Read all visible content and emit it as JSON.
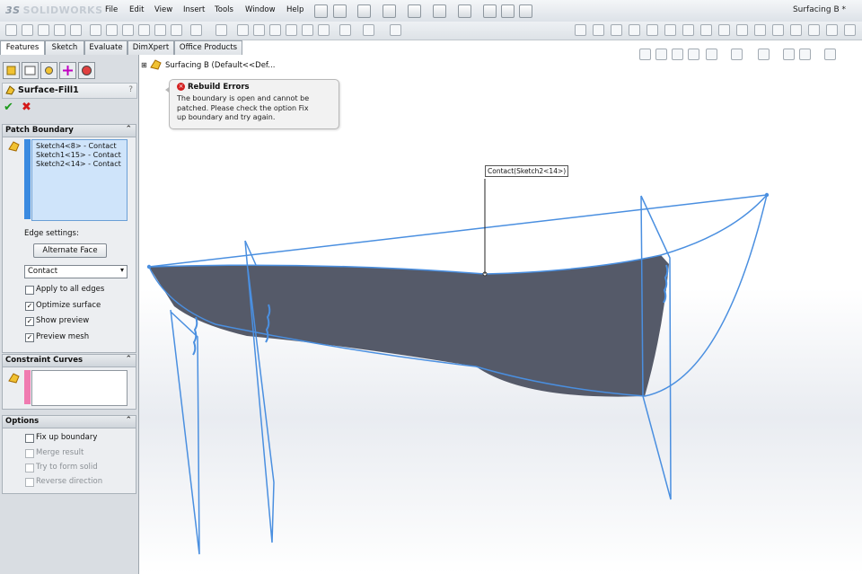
{
  "app": {
    "name": "SOLIDWORKS",
    "ds_mark": "3S",
    "document_title": "Surfacing B *"
  },
  "menu": [
    "File",
    "Edit",
    "View",
    "Insert",
    "Tools",
    "Window",
    "Help"
  ],
  "tabs": [
    "Features",
    "Sketch",
    "Evaluate",
    "DimXpert",
    "Office Products"
  ],
  "feature": {
    "title": "Surface-Fill1",
    "help": "?"
  },
  "patch_boundary": {
    "header": "Patch Boundary",
    "items": [
      "Sketch4<8> - Contact",
      "Sketch1<15> - Contact",
      "Sketch2<14> - Contact"
    ],
    "edge_settings_label": "Edge settings:",
    "alternate_face_button": "Alternate Face",
    "contact_select": "Contact",
    "checkboxes": [
      {
        "label": "Apply to all edges",
        "checked": false
      },
      {
        "label": "Optimize surface",
        "checked": true
      },
      {
        "label": "Show preview",
        "checked": true
      },
      {
        "label": "Preview mesh",
        "checked": true
      }
    ]
  },
  "constraint_curves": {
    "header": "Constraint Curves"
  },
  "options": {
    "header": "Options",
    "checkboxes": [
      {
        "label": "Fix up boundary",
        "enabled": true
      },
      {
        "label": "Merge result",
        "enabled": false
      },
      {
        "label": "Try to form solid",
        "enabled": false
      },
      {
        "label": "Reverse direction",
        "enabled": false
      }
    ]
  },
  "tree": {
    "label": "Surfacing B  (Default<<Def..."
  },
  "rebuild_error": {
    "title": "Rebuild Errors",
    "message_lines": [
      "The boundary is open and cannot be",
      "patched. Please check the option Fix",
      "up boundary and try again."
    ]
  },
  "callout": {
    "label": "Contact(Sketch2<14>)"
  },
  "colors": {
    "surface": "#4d5260",
    "wire": "#4a8fe0",
    "accent": "#2c7fd3"
  }
}
